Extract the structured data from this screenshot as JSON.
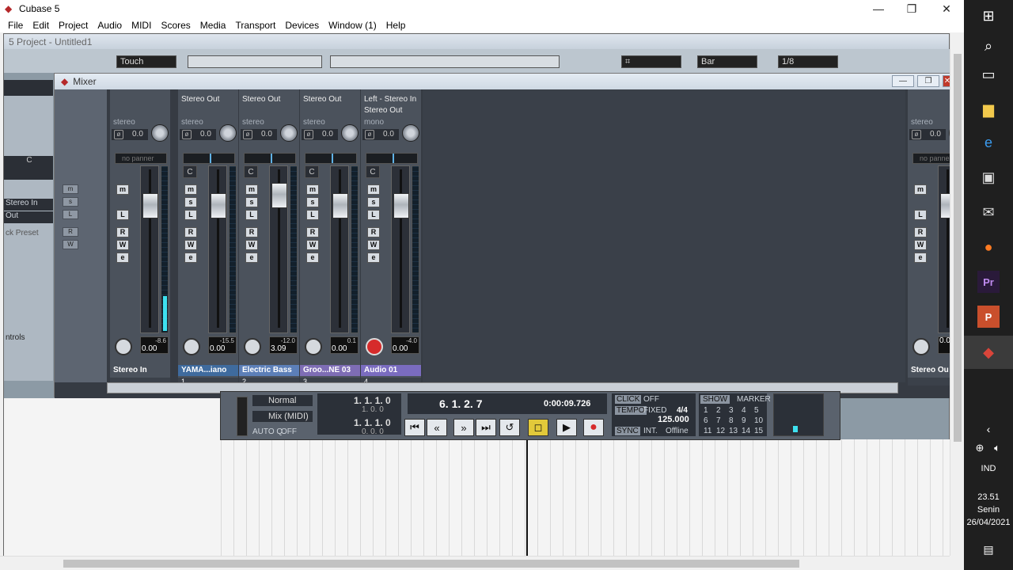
{
  "app": {
    "title": "Cubase 5"
  },
  "menu": [
    "File",
    "Edit",
    "Project",
    "Audio",
    "MIDI",
    "Scores",
    "Media",
    "Transport",
    "Devices",
    "Window (1)",
    "Help"
  ],
  "project": {
    "title": "5 Project - Untitled1",
    "toolbar": {
      "automation_mode": "Touch",
      "snap_type": "Bar",
      "quantize": "1/8"
    },
    "inspector": {
      "stereo_in": "Stereo In",
      "out": "Out",
      "preset": "ck Preset",
      "controls": "ntrols",
      "c_label": "C"
    }
  },
  "mixer": {
    "title": "Mixer",
    "channels": [
      {
        "name": "Stereo In",
        "number": "",
        "output": "",
        "input": "",
        "type": "stereo",
        "gain": "0.0",
        "pan": "no panner",
        "peak": "-8.6",
        "volume": "0.00",
        "level": 0.22,
        "fader": 0.82,
        "rec": false
      },
      {
        "name": "YAMA...iano",
        "number": "1",
        "output": "Stereo Out",
        "input": "",
        "type": "stereo",
        "gain": "0.0",
        "pan": "C",
        "peak": "-15.5",
        "volume": "0.00",
        "level": 0.0,
        "fader": 0.82,
        "rec": false
      },
      {
        "name": "Electric Bass",
        "number": "2",
        "output": "Stereo Out",
        "input": "",
        "type": "stereo",
        "gain": "0.0",
        "pan": "C",
        "peak": "-12.0",
        "volume": "3.09",
        "level": 0.0,
        "fader": 0.9,
        "rec": false
      },
      {
        "name": "Groo...NE 03",
        "number": "3",
        "output": "Stereo Out",
        "input": "",
        "type": "stereo",
        "gain": "0.0",
        "pan": "C",
        "peak": "0.1",
        "volume": "0.00",
        "level": 0.0,
        "fader": 0.82,
        "rec": false
      },
      {
        "name": "Audio 01",
        "number": "4",
        "output": "Stereo Out",
        "input": "Left - Stereo In",
        "type": "mono",
        "gain": "0.0",
        "pan": "C",
        "peak": "-4.0",
        "volume": "0.00",
        "level": 0.0,
        "fader": 0.82,
        "rec": true
      },
      {
        "name": "Stereo Ou",
        "number": "",
        "output": "",
        "input": "",
        "type": "stereo",
        "gain": "0.0",
        "pan": "no panner",
        "peak": "",
        "volume": "0.0",
        "level": 0.0,
        "fader": 0.82,
        "rec": false
      }
    ],
    "buttons": {
      "mute": "m",
      "solo": "s",
      "listen": "L",
      "read": "R",
      "write": "W",
      "edit": "e"
    }
  },
  "transport": {
    "mode": "Normal",
    "mix": "Mix (MIDI)",
    "autoq": "AUTO Q",
    "autoq_value": "OFF",
    "left_locator": "1. 1. 1.   0",
    "left_sub": "1. 0. 0",
    "right_locator": "1. 1. 1.   0",
    "right_sub": "0. 0. 0",
    "position_bars": "6. 1. 2.  7",
    "position_time": "0:00:09.726",
    "click_label": "CLICK",
    "click_value": "OFF",
    "tempo_label": "TEMPO",
    "tempo_mode": "FIXED",
    "signature": "4/4",
    "tempo": "125.000",
    "sync_label": "SYNC",
    "sync_mode": "INT.",
    "sync_state": "Offline",
    "show_label": "SHOW",
    "marker_label": "MARKER",
    "markers": [
      "1",
      "2",
      "3",
      "4",
      "5",
      "6",
      "7",
      "8",
      "9",
      "10",
      "11",
      "12",
      "13",
      "14",
      "15"
    ]
  },
  "taskbar": {
    "language": "IND",
    "time": "23.51",
    "day": "Senin",
    "date": "26/04/2021"
  }
}
